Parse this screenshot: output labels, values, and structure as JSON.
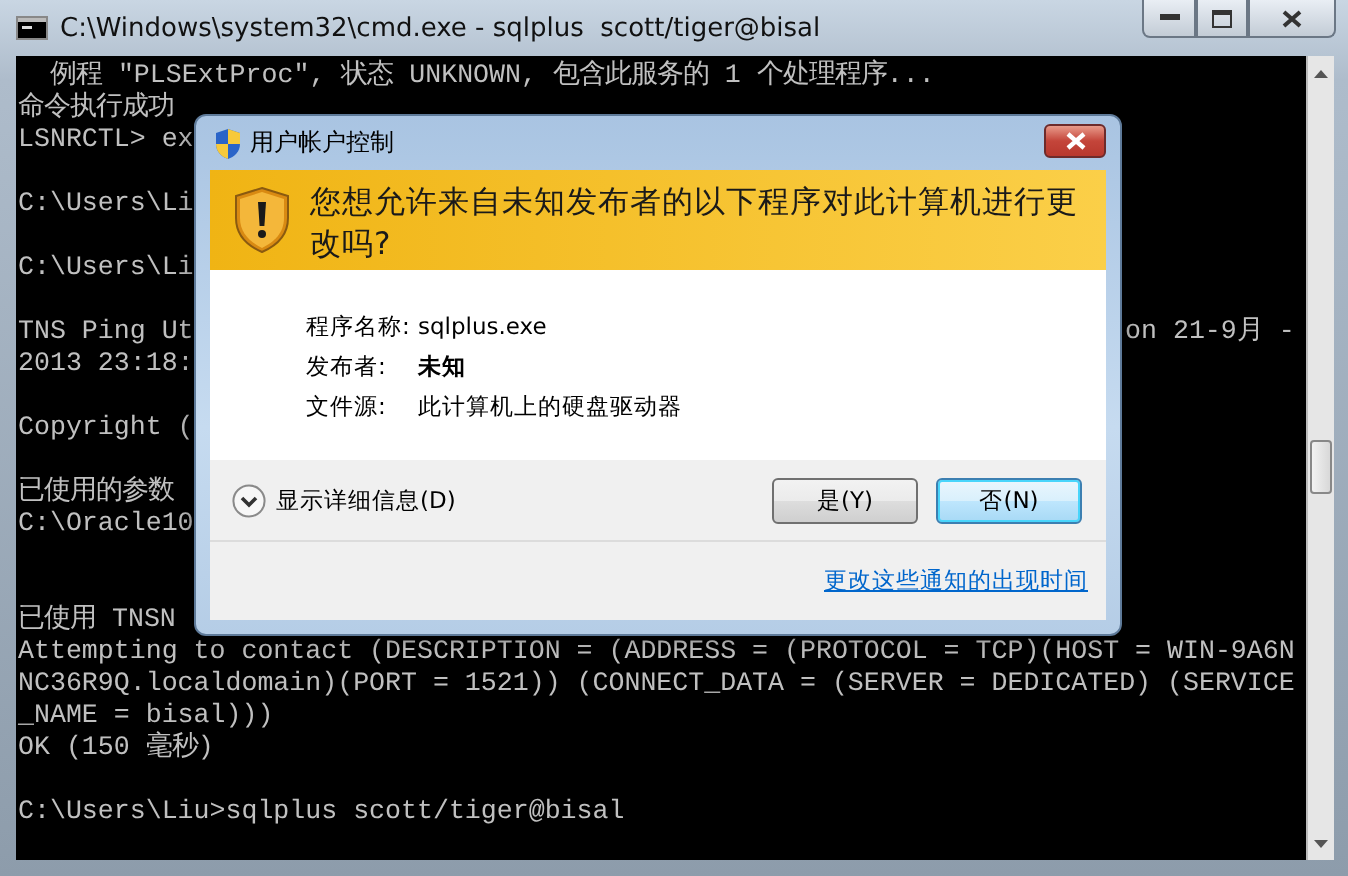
{
  "window": {
    "title": "C:\\Windows\\system32\\cmd.exe - sqlplus  scott/tiger@bisal"
  },
  "console": {
    "lines": [
      {
        "kind": "text",
        "text": "  例程 \"PLSExtProc\", 状态 UNKNOWN, 包含此服务的 1 个处理程序..."
      },
      {
        "kind": "text",
        "text": "命令执行成功"
      },
      {
        "kind": "text",
        "text": "LSNRCTL> ex"
      },
      {
        "kind": "blank"
      },
      {
        "kind": "text",
        "text": "C:\\Users\\Li"
      },
      {
        "kind": "blank"
      },
      {
        "kind": "text",
        "text": "C:\\Users\\Li"
      },
      {
        "kind": "blank"
      },
      {
        "kind": "text",
        "text": "TNS Ping Ut",
        "right": "on 21-9月 -"
      },
      {
        "kind": "text",
        "text": "2013 23:18:"
      },
      {
        "kind": "blank"
      },
      {
        "kind": "text",
        "text": "Copyright ("
      },
      {
        "kind": "blank"
      },
      {
        "kind": "text",
        "text": "已使用的参数"
      },
      {
        "kind": "text",
        "text": "C:\\Oracle10"
      },
      {
        "kind": "blank"
      },
      {
        "kind": "blank"
      },
      {
        "kind": "text",
        "text": "已使用 TNSN"
      },
      {
        "kind": "text",
        "text": "Attempting to contact (DESCRIPTION = (ADDRESS = (PROTOCOL = TCP)(HOST = WIN-9A6N"
      },
      {
        "kind": "text",
        "text": "NC36R9Q.localdomain)(PORT = 1521)) (CONNECT_DATA = (SERVER = DEDICATED) (SERVICE"
      },
      {
        "kind": "text",
        "text": "_NAME = bisal)))"
      },
      {
        "kind": "text",
        "text": "OK (150 毫秒)"
      },
      {
        "kind": "blank"
      },
      {
        "kind": "text",
        "text": "C:\\Users\\Liu>sqlplus scott/tiger@bisal"
      }
    ]
  },
  "dialog": {
    "title": "用户帐户控制",
    "heading": "您想允许来自未知发布者的以下程序对此计算机进行更改吗?",
    "details": [
      {
        "label": "程序名称:",
        "value": "sqlplus.exe",
        "bold": false
      },
      {
        "label": "发布者:",
        "value": "未知",
        "bold": true
      },
      {
        "label": "文件源:",
        "value": "此计算机上的硬盘驱动器",
        "bold": false
      }
    ],
    "toggle": "显示详细信息(D)",
    "buttons": [
      {
        "label": "是(Y)",
        "default": false
      },
      {
        "label": "否(N)",
        "default": true
      }
    ],
    "link": "更改这些通知的出现时间"
  }
}
